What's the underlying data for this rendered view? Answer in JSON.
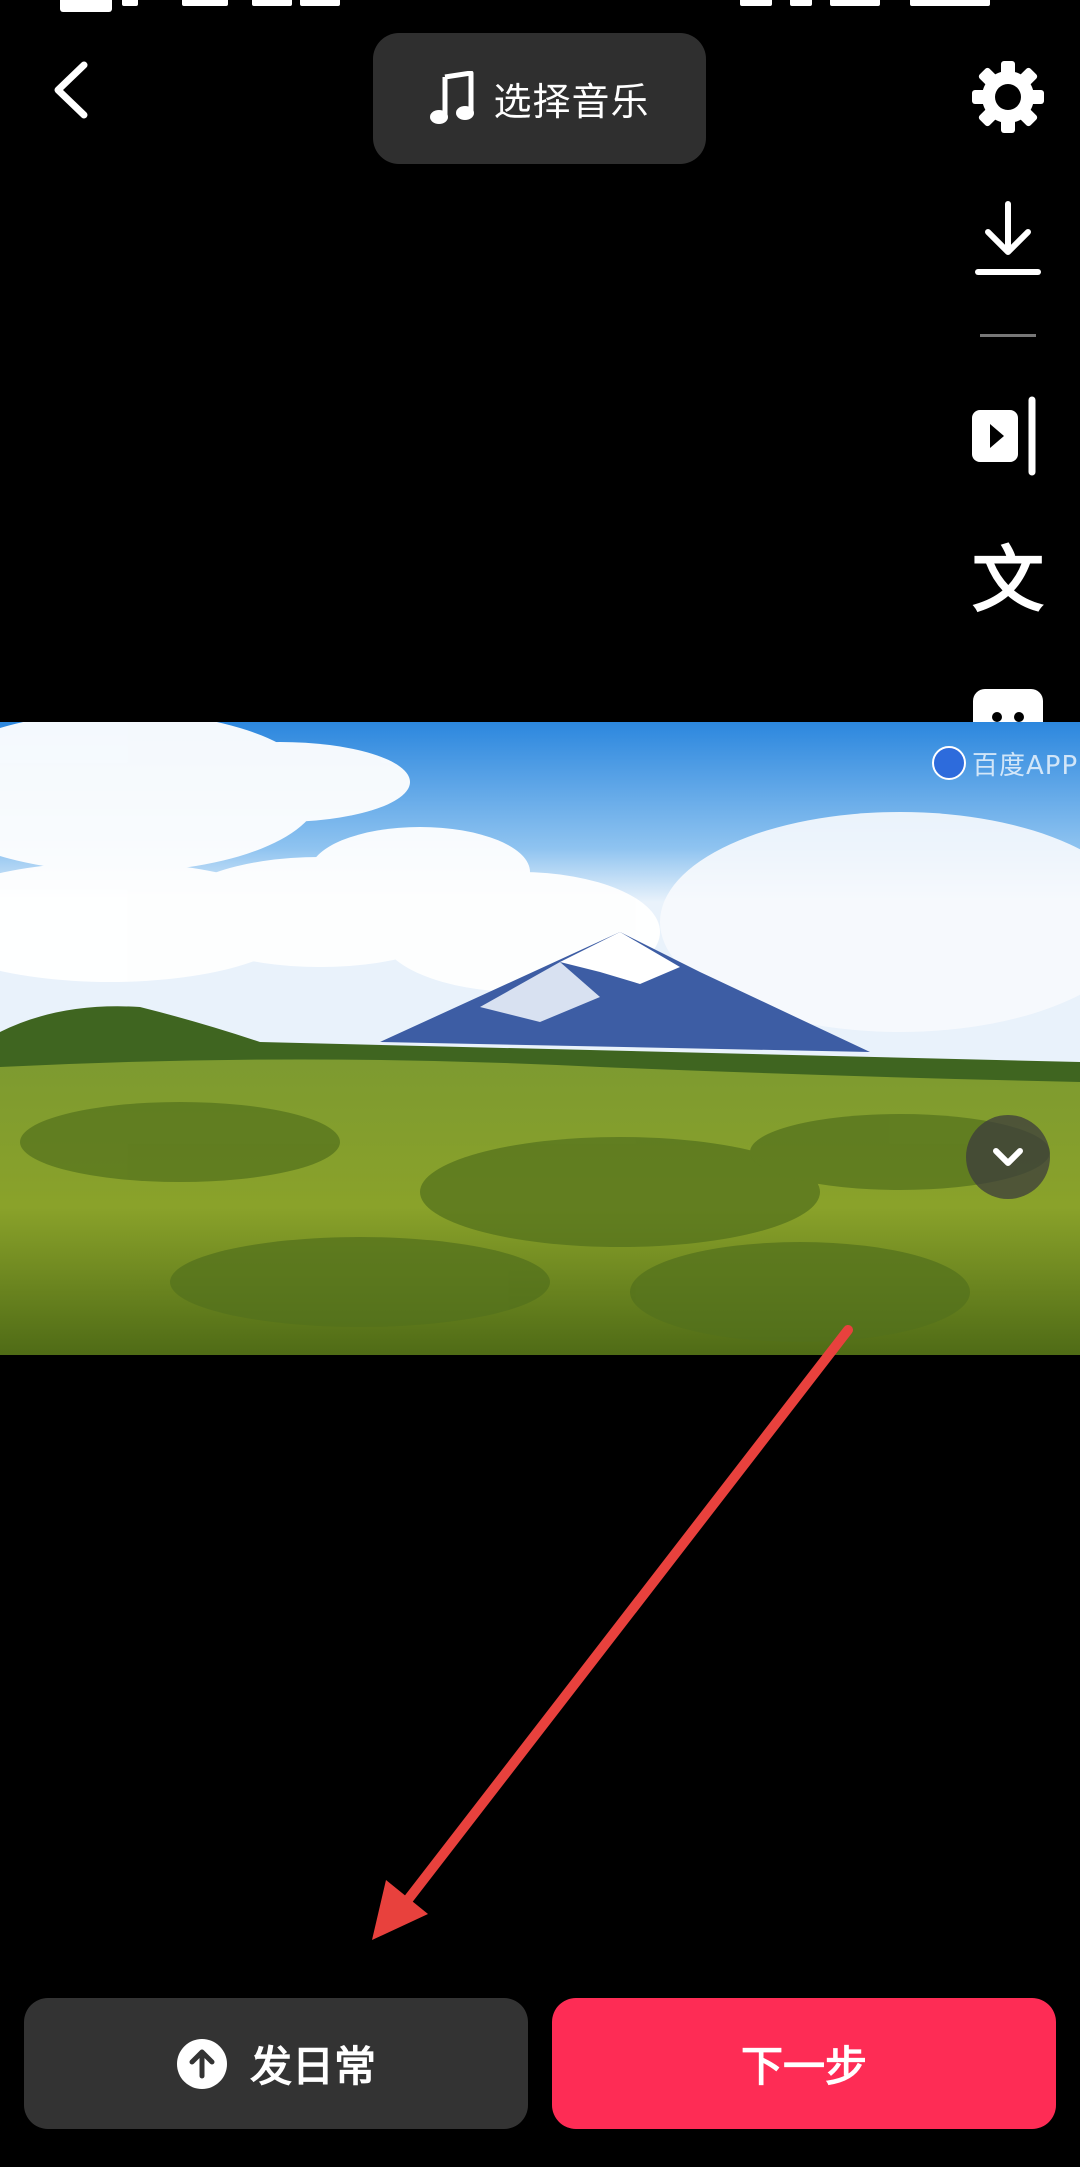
{
  "status_bar": {
    "network_badge": "HD"
  },
  "header": {
    "back_icon": "chevron-left-icon",
    "music_button": {
      "icon": "music-note-icon",
      "label": "选择音乐"
    }
  },
  "toolbar": {
    "items": [
      {
        "icon": "gear-icon"
      },
      {
        "icon": "download-icon"
      },
      {
        "icon": "clip-icon"
      },
      {
        "icon": "text-icon",
        "glyph": "文"
      },
      {
        "icon": "sticker-icon"
      },
      {
        "icon": "effect-icon"
      },
      {
        "icon": "sparkle-icon"
      }
    ],
    "collapse_icon": "chevron-down-icon"
  },
  "video": {
    "watermark_text": "百度APP",
    "watermark_icon": "baidu-paw-icon"
  },
  "footer": {
    "daily_button": {
      "icon": "upload-circle-icon",
      "label": "发日常"
    },
    "next_button": {
      "label": "下一步",
      "color": "#fe2c55"
    }
  },
  "annotation": {
    "arrow_color": "#e8413d"
  }
}
